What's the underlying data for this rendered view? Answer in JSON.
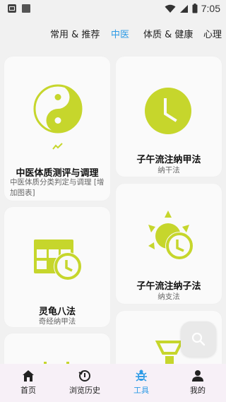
{
  "statusbar": {
    "time": "7:05",
    "icons": [
      "notification-a-icon",
      "notification-b-icon",
      "wifi-icon",
      "signal-icon",
      "battery-icon"
    ]
  },
  "tabs": [
    {
      "label": "常用 & 推荐",
      "active": false
    },
    {
      "label": "中医",
      "active": true
    },
    {
      "label": "体质 & 健康",
      "active": false
    },
    {
      "label": "心理",
      "active": false
    }
  ],
  "accent_color": "#c6d62c",
  "cards": {
    "constitution": {
      "title": "中医体质测评与调理",
      "description": "中医体质分类判定与调理 [增加图表]",
      "icon": "yin-yang-icon",
      "badge_icon": "trend-icon"
    },
    "najia": {
      "title": "子午流注纳甲法",
      "subtitle": "纳干法",
      "icon": "clock-icon"
    },
    "linggui": {
      "title": "灵龟八法",
      "subtitle": "奇经纳甲法",
      "icon": "calendar-clock-icon"
    },
    "nazi": {
      "title": "子午流注纳子法",
      "subtitle": "纳支法",
      "icon": "sun-clock-icon"
    },
    "partial_left": {
      "icon": "partial-icon"
    },
    "partial_right": {
      "icon": "trophy-icon"
    }
  },
  "fab": {
    "icon": "search-icon"
  },
  "bottom_nav": [
    {
      "label": "首页",
      "icon": "home-icon",
      "active": false
    },
    {
      "label": "浏览历史",
      "icon": "history-icon",
      "active": false
    },
    {
      "label": "工具",
      "icon": "tools-icon",
      "active": true
    },
    {
      "label": "我的",
      "icon": "profile-icon",
      "active": false
    }
  ]
}
